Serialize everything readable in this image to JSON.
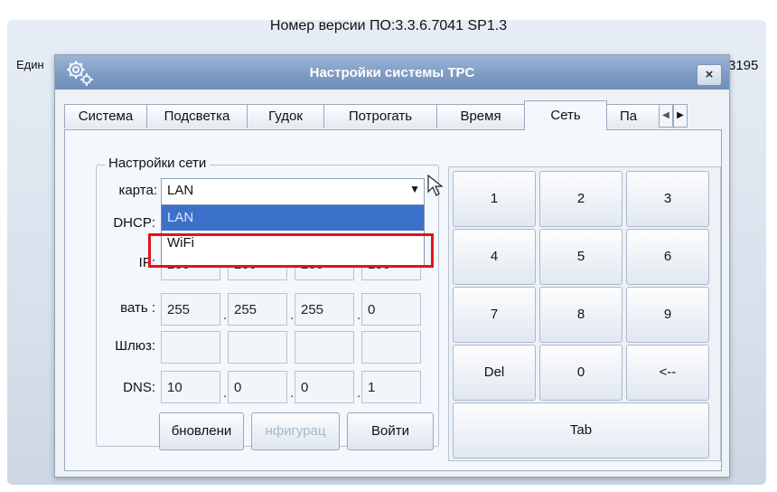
{
  "background": {
    "version_text": "Номер версии ПО:3.3.6.7041 SP1.3",
    "left_text": "Един",
    "right_text": "3195"
  },
  "window": {
    "title": "Настройки системы TPC",
    "close_label": "×"
  },
  "tabs": [
    {
      "label": "Система"
    },
    {
      "label": "Подсветка"
    },
    {
      "label": "Гудок"
    },
    {
      "label": "Потрогать"
    },
    {
      "label": "Время"
    },
    {
      "label": "Сеть"
    },
    {
      "label": "Па"
    }
  ],
  "active_tab": "Сеть",
  "network": {
    "group_title": "Настройки сети",
    "card_label": "карта:",
    "card_value": "LAN",
    "card_options": [
      "LAN",
      "WiFi"
    ],
    "dhcp_label": "DHCP:",
    "ip_label": "IP:",
    "ip": [
      "200",
      "200",
      "200",
      "150"
    ],
    "mask_label": "вать :",
    "mask": [
      "255",
      "255",
      "255",
      "0"
    ],
    "gateway_label": "Шлюз:",
    "gateway": [
      "",
      "",
      "",
      ""
    ],
    "dns_label": "DNS:",
    "dns": [
      "10",
      "0",
      "0",
      "1"
    ],
    "buttons": {
      "refresh": "бновлени",
      "config": "нфигурац",
      "login": "Войти"
    }
  },
  "keypad": {
    "keys": [
      "1",
      "2",
      "3",
      "4",
      "5",
      "6",
      "7",
      "8",
      "9",
      "Del",
      "0",
      "<--"
    ],
    "tab_key": "Tab"
  },
  "colors": {
    "title_bar": "#7e9cc4",
    "selected_option": "#3c71c9",
    "highlight_box": "#e2131c"
  }
}
